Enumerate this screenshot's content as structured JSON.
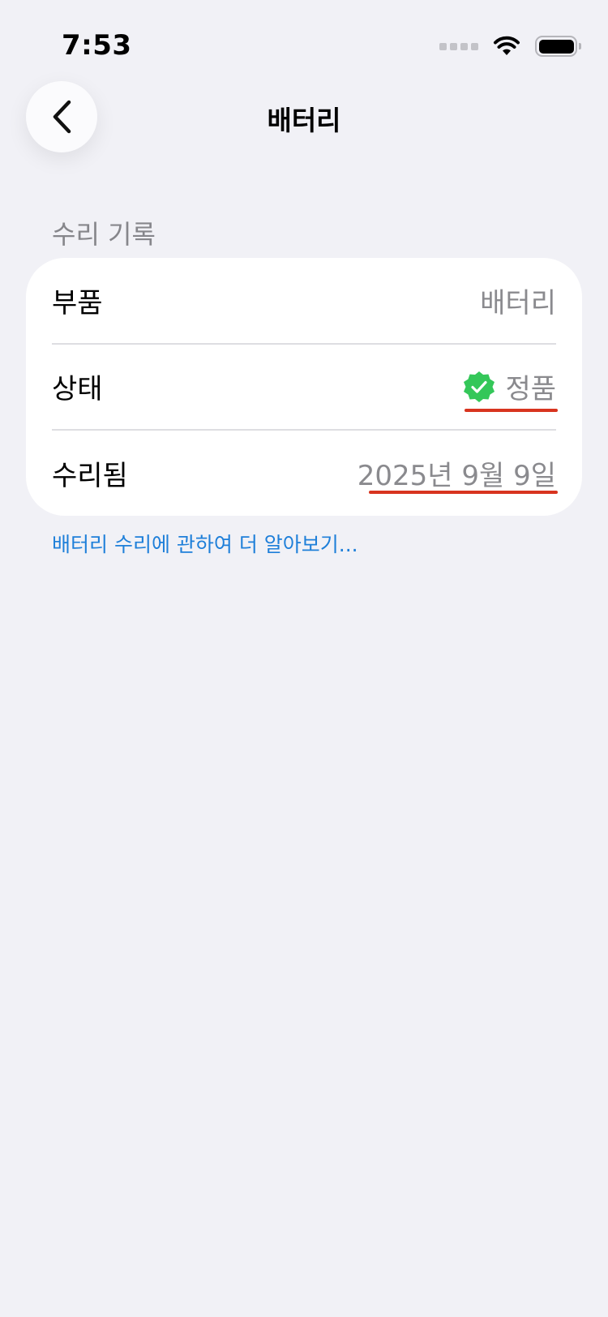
{
  "status_bar": {
    "time": "7:53"
  },
  "nav": {
    "title": "배터리",
    "back_icon": "chevron-left-icon"
  },
  "section": {
    "header": "수리 기록",
    "rows": [
      {
        "label": "부품",
        "value": "배터리"
      },
      {
        "label": "상태",
        "value": "정품",
        "icon": "verified-badge-icon",
        "icon_color": "#34c759"
      },
      {
        "label": "수리됨",
        "value": "2025년 9월 9일"
      }
    ]
  },
  "footer_link": "배터리 수리에 관하여 더 알아보기...",
  "colors": {
    "background": "#f1f1f6",
    "card": "#ffffff",
    "secondary_text": "#8a8a8e",
    "link": "#1e7fd9",
    "annotation_underline": "#d8341f"
  }
}
